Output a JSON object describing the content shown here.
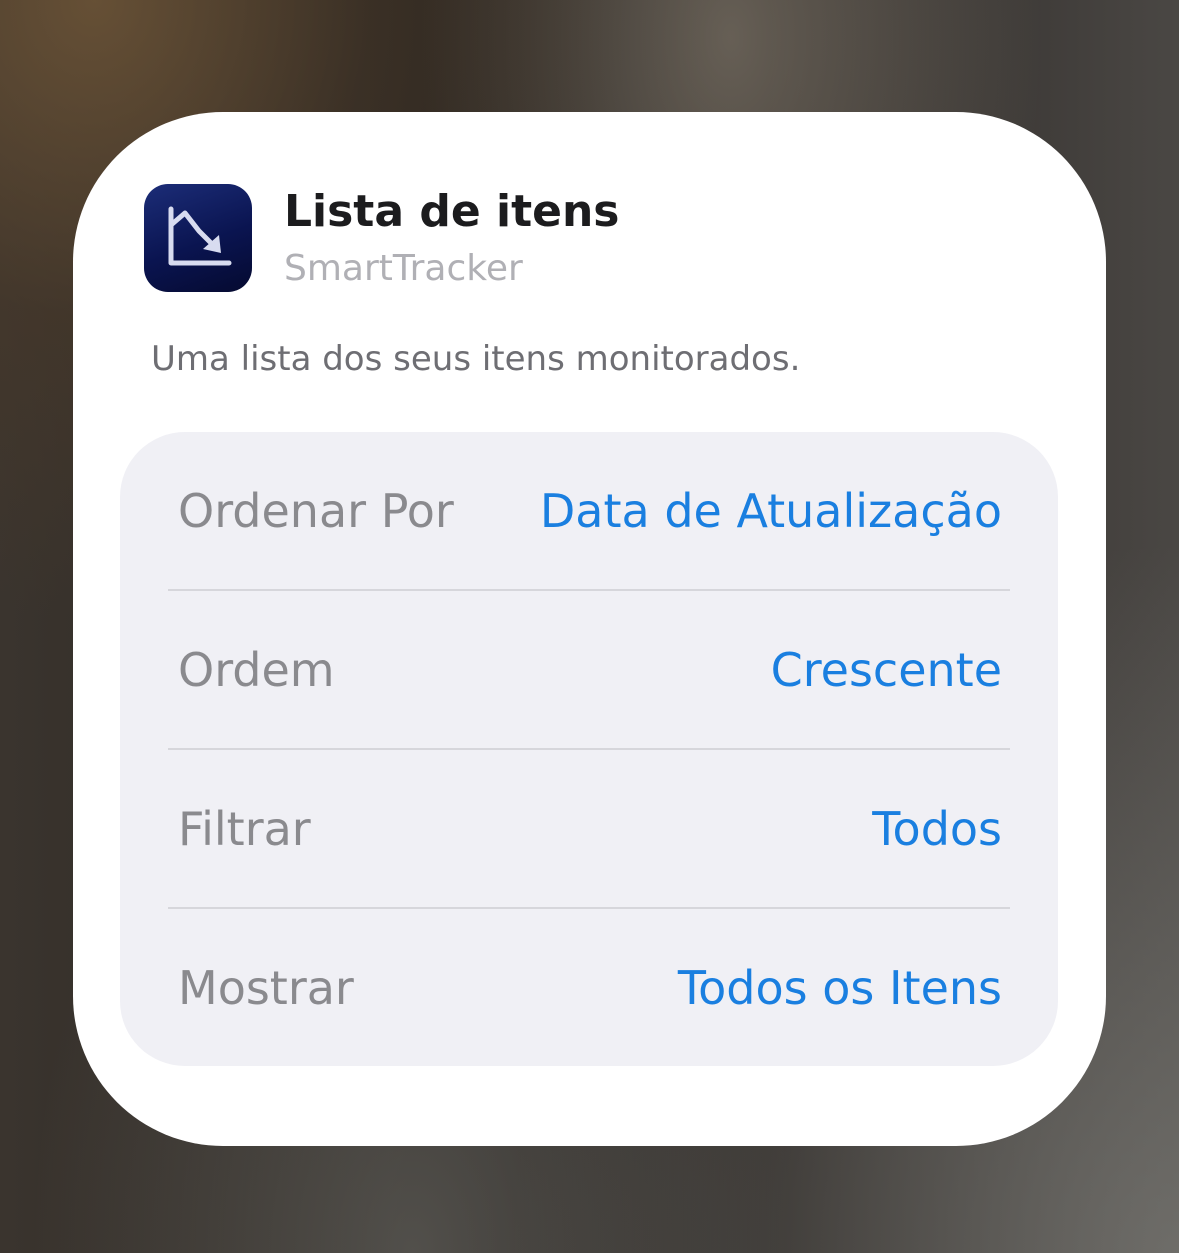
{
  "widget": {
    "title": "Lista de itens",
    "app_name": "SmartTracker",
    "description": "Uma lista dos seus itens monitorados.",
    "icon": "chart-trend-down-icon",
    "accent_color": "#1a7fe0"
  },
  "settings": [
    {
      "label": "Ordenar Por",
      "value": "Data de Atualização"
    },
    {
      "label": "Ordem",
      "value": "Crescente"
    },
    {
      "label": "Filtrar",
      "value": "Todos"
    },
    {
      "label": "Mostrar",
      "value": "Todos os Itens"
    }
  ]
}
